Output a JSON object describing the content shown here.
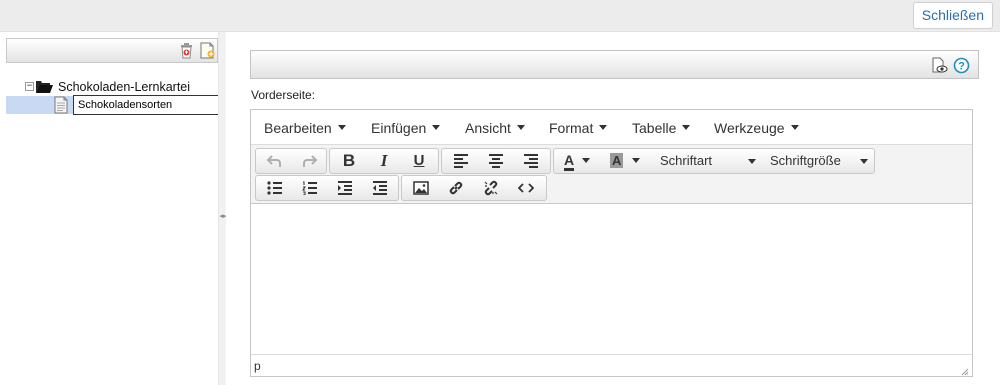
{
  "topbar": {
    "close_label": "Schließen"
  },
  "tree": {
    "root_toggle": "−",
    "root_label": "Schokoladen-Lernkartei",
    "child_value": "Schokoladensorten"
  },
  "editor": {
    "front_label": "Vorderseite:",
    "menu": [
      "Bearbeiten",
      "Einfügen",
      "Ansicht",
      "Format",
      "Tabelle",
      "Werkzeuge"
    ],
    "font_family_label": "Schriftart",
    "font_size_label": "Schriftgröße",
    "status_path": "p"
  },
  "icons": {
    "trash": "trash-icon",
    "new_card": "new-card-icon",
    "preview": "preview-icon",
    "help": "help-icon"
  },
  "colors": {
    "accent": "#2a6fa8",
    "selection": "#c7d9f3",
    "help": "#1a8fc0"
  }
}
